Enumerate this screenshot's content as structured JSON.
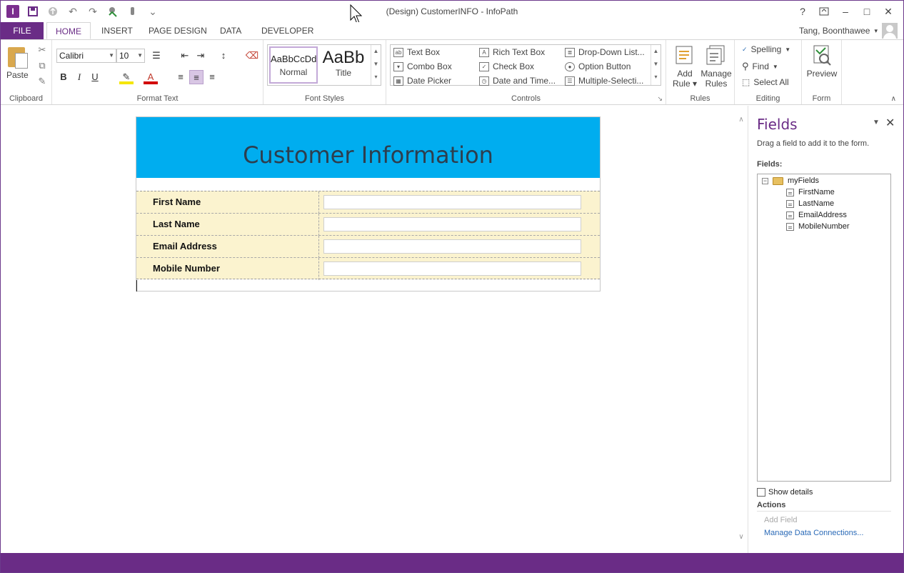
{
  "window": {
    "title": "(Design) CustomerINFO - InfoPath",
    "help": "?",
    "min": "–",
    "max": "□",
    "close": "✕"
  },
  "qat": {
    "app_glyph": "I",
    "undo": "↶",
    "redo": "↷",
    "customize": "⌄"
  },
  "tabs": [
    "FILE",
    "HOME",
    "INSERT",
    "PAGE DESIGN",
    "DATA",
    "DEVELOPER"
  ],
  "user": {
    "name": "Tang, Boonthawee",
    "menu": "▾"
  },
  "ribbon": {
    "clipboard": {
      "paste": "Paste",
      "label": "Clipboard"
    },
    "format_text": {
      "font": "Calibri",
      "size": "10",
      "bold": "B",
      "italic": "I",
      "underline": "U",
      "label": "Format Text"
    },
    "font_styles": {
      "normal_sample": "AaBbCcDd",
      "normal": "Normal",
      "title_sample": "AaBb",
      "title": "Title",
      "label": "Font Styles"
    },
    "controls": {
      "items": [
        "Text Box",
        "Combo Box",
        "Date Picker",
        "Rich Text Box",
        "Check Box",
        "Date and Time...",
        "Drop-Down List...",
        "Option Button",
        "Multiple-Selecti..."
      ],
      "label": "Controls"
    },
    "rules": {
      "add_rule": "Add",
      "add_rule2": "Rule ▾",
      "manage": "Manage",
      "manage2": "Rules",
      "label": "Rules"
    },
    "editing": {
      "spelling": "Spelling",
      "find": "Find",
      "select_all": "Select All",
      "label": "Editing"
    },
    "form": {
      "preview": "Preview",
      "label": "Form"
    }
  },
  "form": {
    "title": "Customer Information",
    "rows": [
      {
        "label": "First Name",
        "value": ""
      },
      {
        "label": "Last Name",
        "value": ""
      },
      {
        "label": "Email Address",
        "value": ""
      },
      {
        "label": "Mobile Number",
        "value": ""
      }
    ]
  },
  "pane": {
    "title": "Fields",
    "description": "Drag a field to add it to the form.",
    "fields_label": "Fields:",
    "root": "myFields",
    "fields": [
      "FirstName",
      "LastName",
      "EmailAddress",
      "MobileNumber"
    ],
    "show_details": "Show details",
    "actions_label": "Actions",
    "add_field": "Add Field",
    "manage_connections": "Manage Data Connections..."
  },
  "colors": {
    "accent": "#6a2c86",
    "form_header": "#00adef",
    "form_body": "#fbf3cf",
    "link": "#2a6ab7"
  },
  "icons": [
    "app-logo-icon",
    "save-icon",
    "undo-icon",
    "redo-icon",
    "paste-icon",
    "cut-icon",
    "copy-icon",
    "format-painter-icon",
    "spelling-icon",
    "find-icon",
    "select-all-icon",
    "preview-icon",
    "folder-icon",
    "field-icon",
    "close-icon"
  ]
}
